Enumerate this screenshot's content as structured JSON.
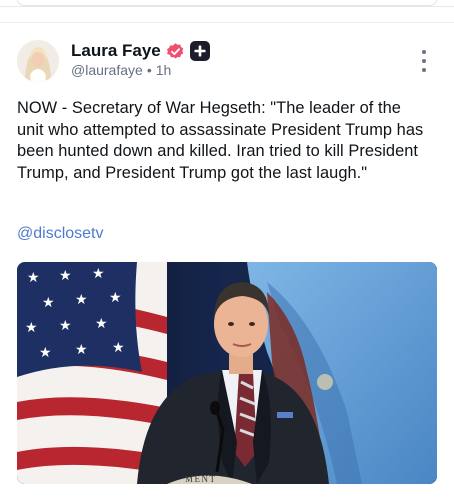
{
  "post": {
    "author": {
      "display_name": "Laura Faye",
      "handle": "@laurafaye",
      "time": "1h"
    },
    "body": "NOW - Secretary of War Hegseth: \"The leader of the unit who attempted to assassinate President Trump has been hunted down and killed. Iran tried to kill President Trump, and President Trump got the last laugh.\"",
    "mention": "@disclosetv",
    "media_seal_text": "MENT"
  },
  "colors": {
    "verified_badge": "#f0506e",
    "mention": "#4b7bd0",
    "meta_text": "#667085"
  },
  "icons": {
    "verified": "verified-badge-icon",
    "plus": "plus-badge-icon",
    "more": "more-options-icon"
  }
}
